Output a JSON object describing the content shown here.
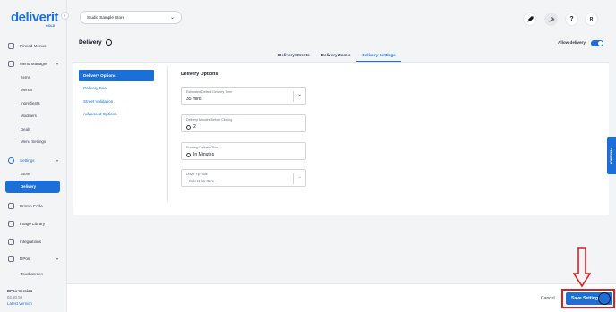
{
  "sidebar": {
    "logo": "deliverit",
    "logo_sub": "GOLD",
    "items": [
      {
        "label": "Pinned Menus",
        "icon": "pin-icon"
      },
      {
        "label": "Menu Manager",
        "icon": "menu-icon",
        "sub": [
          "Items",
          "Menus",
          "Ingredients",
          "Modifiers",
          "Deals",
          "Menu Settings"
        ]
      },
      {
        "label": "Settings",
        "icon": "settings-icon",
        "sub": [
          "Store",
          "Delivery"
        ]
      },
      {
        "label": "Promo Code",
        "icon": "promo-icon"
      },
      {
        "label": "Image Library",
        "icon": "image-icon"
      },
      {
        "label": "Integrations",
        "icon": "integrations-icon"
      },
      {
        "label": "DPos",
        "icon": "dpos-icon",
        "sub": [
          "Touchscreen"
        ]
      }
    ],
    "version_title": "DPos Version",
    "version_number": "02.20.53",
    "version_link": "Latest Version"
  },
  "topbar": {
    "store": "Studio Sample Store",
    "avatar": "R",
    "help": "?"
  },
  "page": {
    "title": "Delivery",
    "allow_label": "Allow delivery",
    "allow_on": true,
    "tabs": [
      "Delivery Streets",
      "Delivery Zones",
      "Delivery Settings"
    ],
    "active_tab": "Delivery Settings"
  },
  "left_menu": [
    "Delivery Options",
    "Delivery Fee",
    "Street Validation",
    "Advanced Options"
  ],
  "section": {
    "title": "Delivery Options",
    "fields": [
      {
        "label": "Estimated Default Delivery Time",
        "value": "35 mins"
      },
      {
        "label": "Delivery Minutes Before Closing",
        "value": "2"
      },
      {
        "label": "Running Delivery Time",
        "value": "In Minutes"
      },
      {
        "label": "Driver Tip Rule",
        "placeholder": "--Select an Item--"
      }
    ]
  },
  "feedback": "Feedback",
  "footer": {
    "cancel": "Cancel",
    "save": "Save Settings"
  },
  "colors": {
    "accent": "#1d6fd8",
    "highlight": "#e11d1d"
  }
}
